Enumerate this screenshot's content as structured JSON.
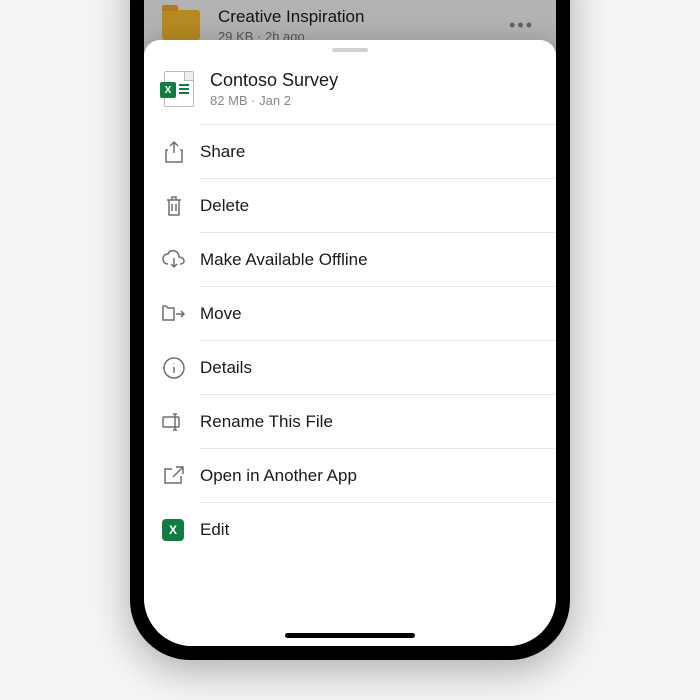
{
  "background": {
    "title": "Creative Inspiration",
    "meta": "29 KB · 2h ago"
  },
  "sheet": {
    "file": {
      "name": "Contoso Survey",
      "meta": "82 MB · Jan 2"
    },
    "actions": {
      "share": "Share",
      "delete": "Delete",
      "offline": "Make Available Offline",
      "move": "Move",
      "details": "Details",
      "rename": "Rename This File",
      "openin": "Open in Another App",
      "edit": "Edit"
    }
  }
}
